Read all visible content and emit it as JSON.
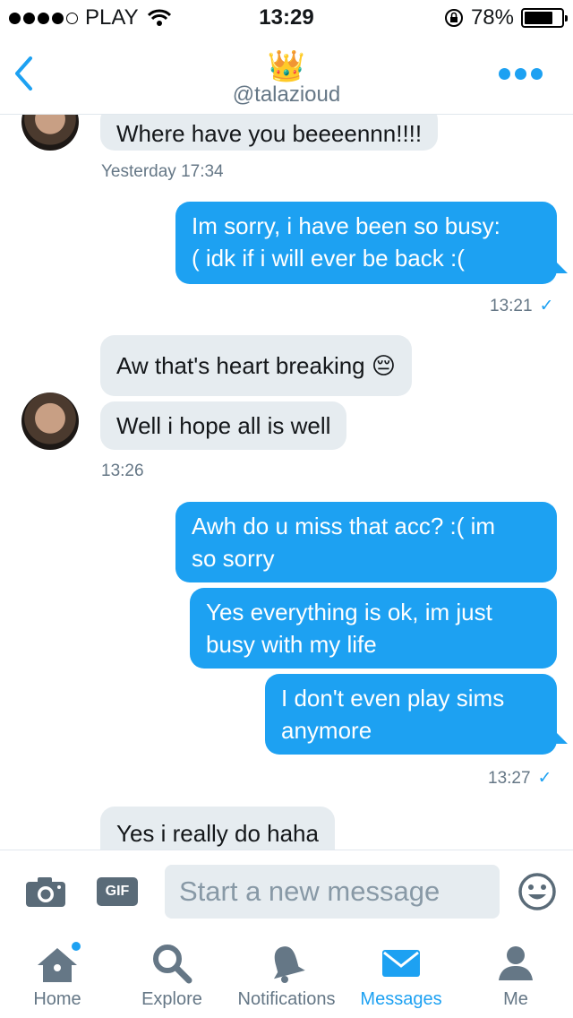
{
  "status": {
    "carrier": "PLAY",
    "time": "13:29",
    "battery": "78%",
    "battery_level": 0.78
  },
  "header": {
    "crown": "👑",
    "handle": "@talazioud"
  },
  "messages": {
    "m1": "Where have you beeeennn!!!!",
    "t1": "Yesterday 17:34",
    "m2_l1": "Im sorry, i have been so busy:",
    "m2_l2": "( idk if i will ever be back :(",
    "t2": "13:21",
    "m3": "Aw that's heart breaking 😔",
    "m4": "Well i hope all is well",
    "t3": "13:26",
    "m5_l1": "Awh do u miss that acc? :( im",
    "m5_l2": "so sorry",
    "m6_l1": "Yes everything is ok, im just",
    "m6_l2": "busy with my life",
    "m7_l1": "I don't even play sims",
    "m7_l2": "anymore",
    "t4": "13:27",
    "m8": "Yes i really do haha",
    "check": "✓"
  },
  "composer": {
    "gif_label": "GIF",
    "placeholder": "Start a new message"
  },
  "tabs": {
    "home": "Home",
    "explore": "Explore",
    "notifications": "Notifications",
    "messages": "Messages",
    "me": "Me"
  },
  "colors": {
    "accent": "#1da1f2",
    "incoming_bubble": "#e6ecf0",
    "secondary_text": "#657786"
  }
}
